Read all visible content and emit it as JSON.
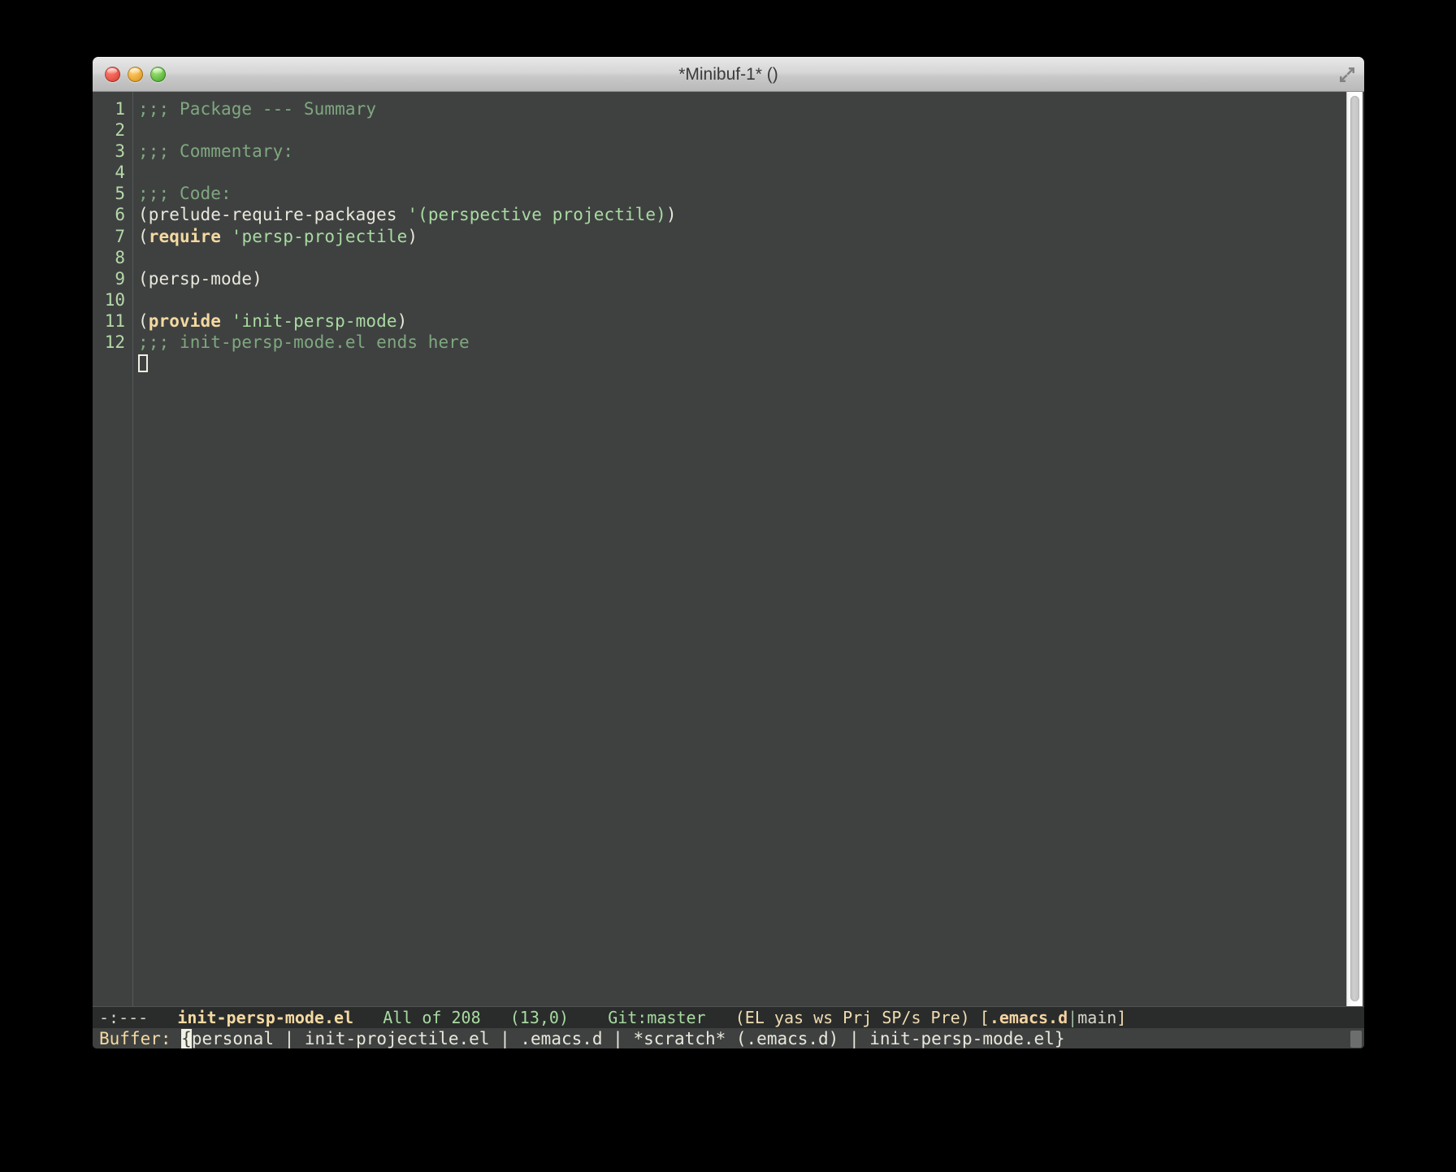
{
  "window": {
    "title": "*Minibuf-1* ()",
    "controls": [
      {
        "name": "close-button",
        "label": ""
      },
      {
        "name": "minimize-button",
        "label": ""
      },
      {
        "name": "zoom-button",
        "label": ""
      }
    ],
    "resize_icon": "resize-corner-icon"
  },
  "editor": {
    "line_numbers": [
      "1",
      "2",
      "3",
      "4",
      "5",
      "6",
      "7",
      "8",
      "9",
      "10",
      "11",
      "12"
    ],
    "lines": [
      {
        "n": "1",
        "segments": [
          {
            "cls": "comment",
            "t": ";;; Package --- Summary"
          }
        ]
      },
      {
        "n": "2",
        "segments": [
          {
            "cls": "plain",
            "t": ""
          }
        ]
      },
      {
        "n": "3",
        "segments": [
          {
            "cls": "comment",
            "t": ";;; Commentary:"
          }
        ]
      },
      {
        "n": "4",
        "segments": [
          {
            "cls": "plain",
            "t": ""
          }
        ]
      },
      {
        "n": "5",
        "segments": [
          {
            "cls": "comment",
            "t": ";;; Code:"
          }
        ]
      },
      {
        "n": "6",
        "segments": [
          {
            "cls": "plain",
            "t": "(prelude-require-packages "
          },
          {
            "cls": "sym",
            "t": "'(perspective projectile)"
          },
          {
            "cls": "plain",
            "t": ")"
          }
        ]
      },
      {
        "n": "7",
        "segments": [
          {
            "cls": "plain",
            "t": "("
          },
          {
            "cls": "keyword",
            "t": "require"
          },
          {
            "cls": "plain",
            "t": " "
          },
          {
            "cls": "sym",
            "t": "'persp-projectile"
          },
          {
            "cls": "plain",
            "t": ")"
          }
        ]
      },
      {
        "n": "8",
        "segments": [
          {
            "cls": "plain",
            "t": ""
          }
        ]
      },
      {
        "n": "9",
        "segments": [
          {
            "cls": "plain",
            "t": "(persp-mode)"
          }
        ]
      },
      {
        "n": "10",
        "segments": [
          {
            "cls": "plain",
            "t": ""
          }
        ]
      },
      {
        "n": "11",
        "segments": [
          {
            "cls": "plain",
            "t": "("
          },
          {
            "cls": "keyword",
            "t": "provide"
          },
          {
            "cls": "plain",
            "t": " "
          },
          {
            "cls": "sym",
            "t": "'init-persp-mode"
          },
          {
            "cls": "plain",
            "t": ")"
          }
        ]
      },
      {
        "n": "12",
        "segments": [
          {
            "cls": "comment",
            "t": ";;; init-persp-mode.el ends here"
          }
        ]
      }
    ],
    "cursor": {
      "name": "text-cursor",
      "line": 13,
      "column": 0
    },
    "scrollbar": {
      "name": "vertical-scrollbar",
      "thumb_top_pct": 0,
      "thumb_height_pct": 100
    }
  },
  "mode_line": {
    "indicator": "-:---",
    "buffer_name": "init-persp-mode.el",
    "position": "All of 208",
    "line_col": "(13,0)",
    "vc": "Git:master",
    "minor_modes": "(EL yas ws Prj SP/s Pre)",
    "persp_open": "[",
    "persp_project": ".emacs.d",
    "persp_sep": "|",
    "persp_name": "main",
    "persp_close": "]"
  },
  "minibuffer": {
    "prompt": "Buffer: ",
    "cursor_char": "{",
    "value": "personal | init-projectile.el | .emacs.d | *scratch* (.emacs.d) | init-persp-mode.el}",
    "scroll_thumb": "minibuffer-scrollbar"
  },
  "colors": {
    "background": "#3f4141",
    "mode_line_bg": "#2a2c2c",
    "comment": "#7fa87f",
    "keyword": "#f4d9a0",
    "symbol": "#a8dba0",
    "foreground": "#e8e8dc",
    "line_number": "#b5d9a8",
    "desktop": "#000000"
  }
}
